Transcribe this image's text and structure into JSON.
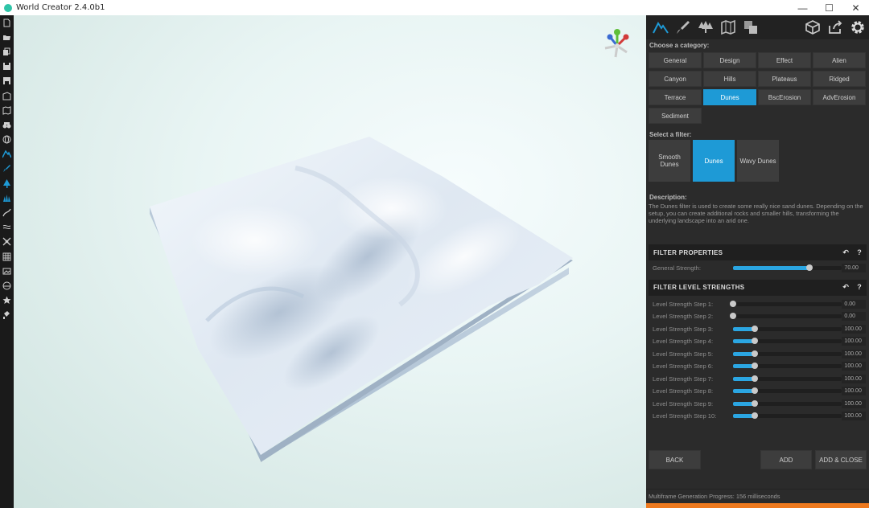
{
  "window": {
    "title": "World Creator 2.4.0b1",
    "controls": [
      "minimize",
      "maximize",
      "close"
    ]
  },
  "toolbar_icons": [
    "new-file-icon",
    "open-folder-icon",
    "import-icon",
    "save-icon",
    "save-as-icon",
    "export-icon",
    "map-icon",
    "binoculars-icon",
    "globe-icon",
    "terrain-icon",
    "brush-icon",
    "tree-icon",
    "grass-icon",
    "road-icon",
    "rivers-icon",
    "transform-icon",
    "grid-icon",
    "image-icon",
    "sky-icon",
    "star-icon",
    "paint-bucket-icon"
  ],
  "tabs": [
    "terrain-filters-tab",
    "brush-tab",
    "vegetation-tab",
    "map-tab",
    "layers-tab",
    "object-tab",
    "export-tab",
    "settings-tab"
  ],
  "colors": {
    "accent": "#1e9ad6",
    "progress": "#ee7a1f",
    "slider_fill": "#2ba6e2"
  },
  "category": {
    "label": "Choose a category:",
    "items": [
      "General",
      "Design",
      "Effect",
      "Alien",
      "Canyon",
      "Hills",
      "Plateaus",
      "Ridged",
      "Terrace",
      "Dunes",
      "BscErosion",
      "AdvErosion",
      "Sediment"
    ],
    "selected": "Dunes"
  },
  "filter": {
    "label": "Select a filter:",
    "items": [
      "Smooth Dunes",
      "Dunes",
      "Wavy Dunes"
    ],
    "selected": "Dunes"
  },
  "description": {
    "label": "Description:",
    "text": "The Dunes filter is used to create some really nice sand dunes. Depending on the setup, you can create additional rocks and smaller hills, transforming the underlying landscape into an arid one."
  },
  "filter_properties": {
    "title": "FILTER PROPERTIES",
    "rows": [
      {
        "label": "General Strength:",
        "value": "70.00",
        "level": 0.7
      }
    ]
  },
  "filter_levels": {
    "title": "FILTER LEVEL STRENGTHS",
    "rows": [
      {
        "label": "Level Strength Step 1:",
        "value": "0.00",
        "level": 0.0
      },
      {
        "label": "Level Strength Step 2:",
        "value": "0.00",
        "level": 0.0
      },
      {
        "label": "Level Strength Step 3:",
        "value": "100.00",
        "level": 0.2
      },
      {
        "label": "Level Strength Step 4:",
        "value": "100.00",
        "level": 0.2
      },
      {
        "label": "Level Strength Step 5:",
        "value": "100.00",
        "level": 0.2
      },
      {
        "label": "Level Strength Step 6:",
        "value": "100.00",
        "level": 0.2
      },
      {
        "label": "Level Strength Step 7:",
        "value": "100.00",
        "level": 0.2
      },
      {
        "label": "Level Strength Step 8:",
        "value": "100.00",
        "level": 0.2
      },
      {
        "label": "Level Strength Step 9:",
        "value": "100.00",
        "level": 0.2
      },
      {
        "label": "Level Strength Step 10:",
        "value": "100.00",
        "level": 0.2
      }
    ]
  },
  "buttons": {
    "back": "BACK",
    "add": "ADD",
    "add_close": "ADD & CLOSE"
  },
  "status": {
    "text": "Multiframe Generation Progress: 156 milliseconds"
  }
}
